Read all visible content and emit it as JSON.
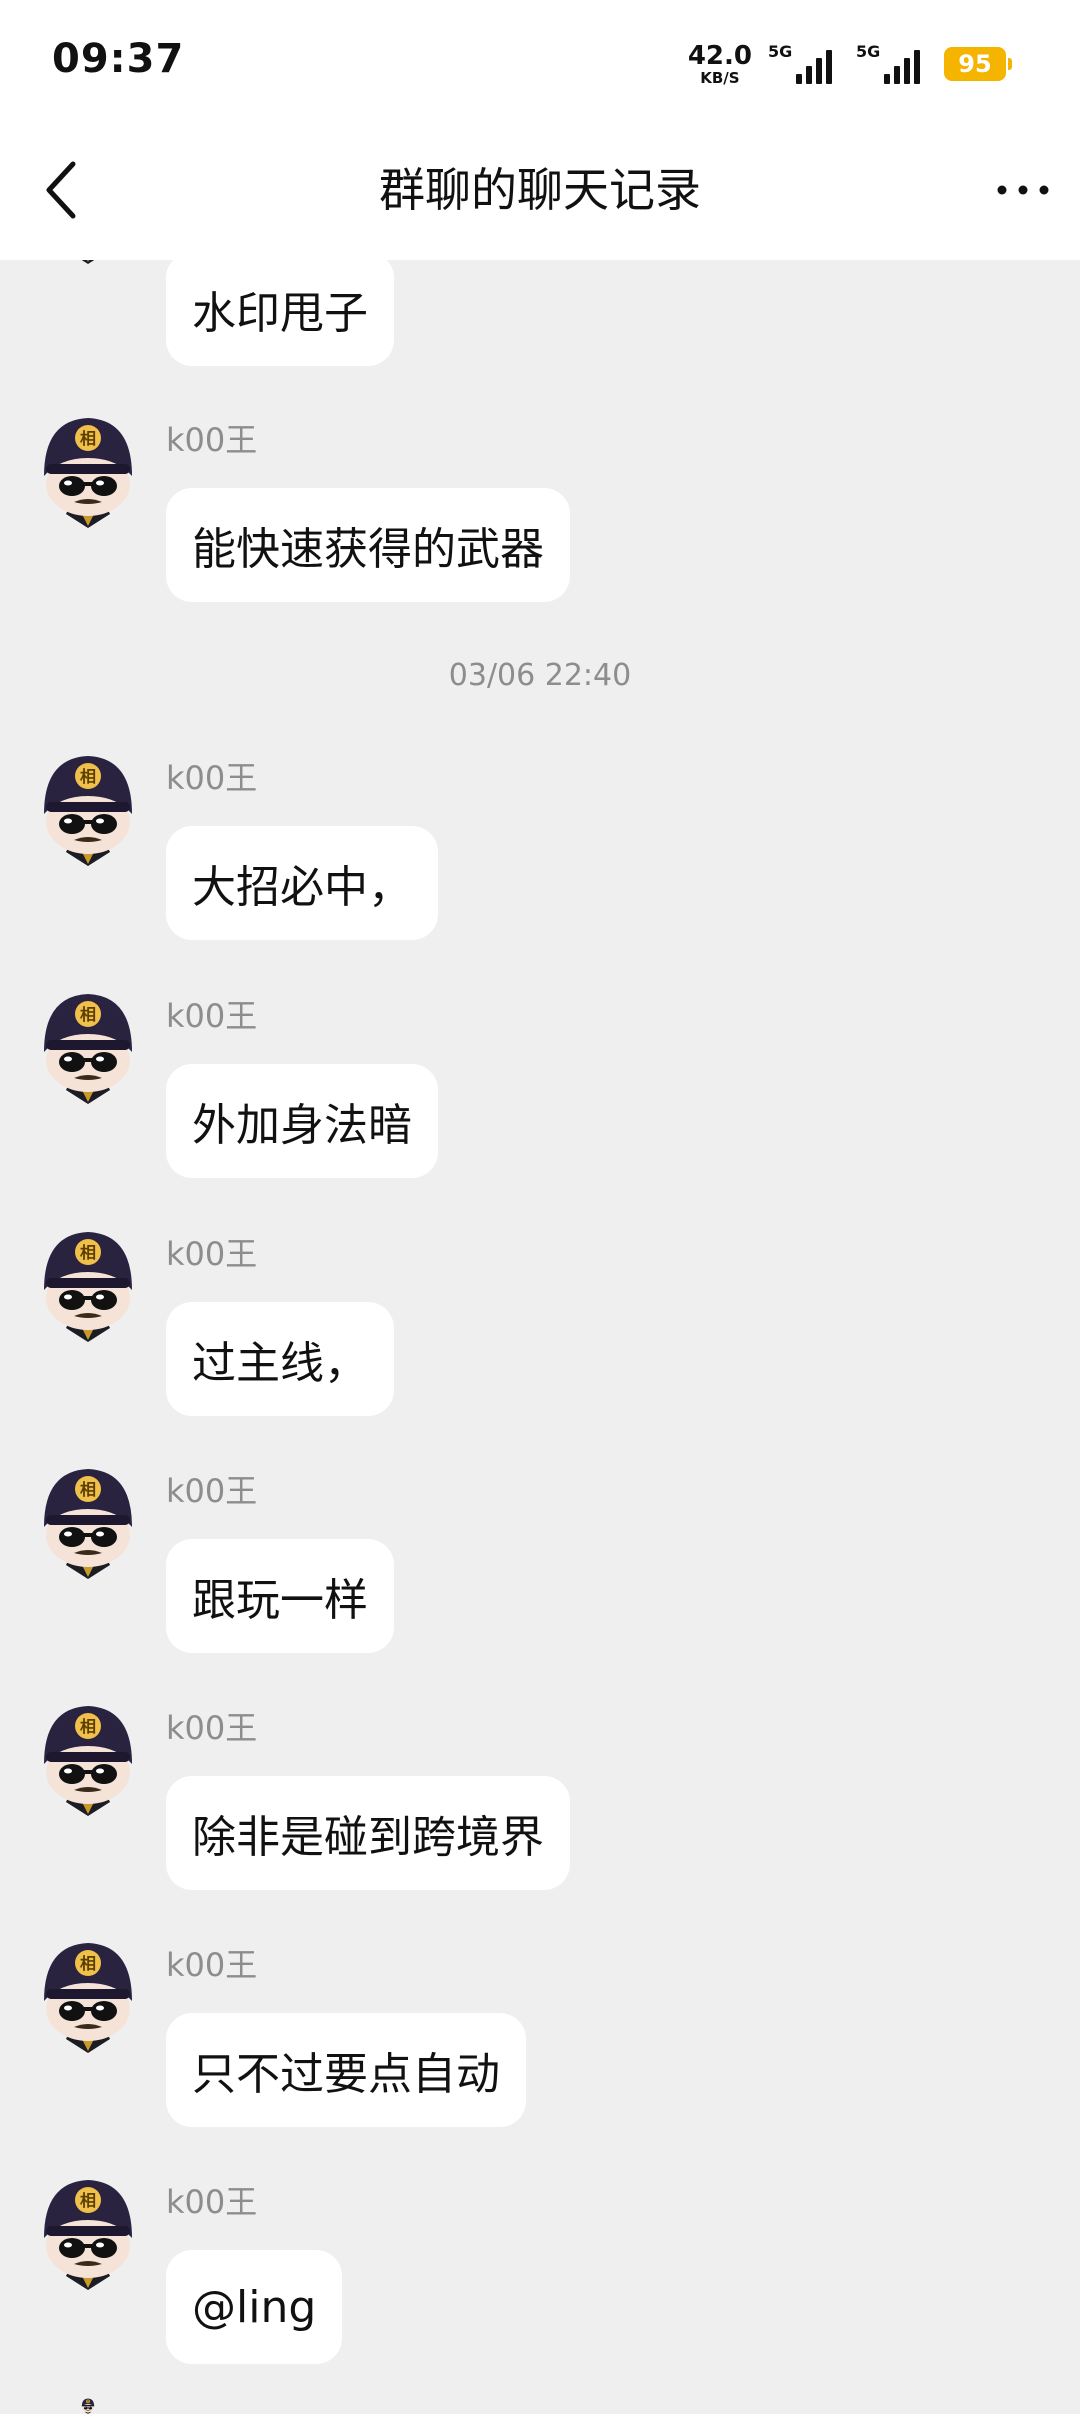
{
  "status_bar": {
    "time": "09:37",
    "net_speed": "42.0",
    "net_unit": "KB/S",
    "sim1_label": "5G",
    "sim2_label": "5G",
    "battery": "95"
  },
  "header": {
    "title": "群聊的聊天记录"
  },
  "timestamp": "03/06 22:40",
  "messages": [
    {
      "sender": "",
      "text": "水印甩子"
    },
    {
      "sender": "k00王",
      "text": "能快速获得的武器"
    },
    {
      "sender": "k00王",
      "text": "大招必中，"
    },
    {
      "sender": "k00王",
      "text": "外加身法暗"
    },
    {
      "sender": "k00王",
      "text": "过主线，"
    },
    {
      "sender": "k00王",
      "text": "跟玩一样"
    },
    {
      "sender": "k00王",
      "text": "除非是碰到跨境界"
    },
    {
      "sender": "k00王",
      "text": "只不过要点自动"
    },
    {
      "sender": "k00王",
      "text": "@ling"
    }
  ],
  "colors": {
    "background": "#efefef",
    "bubble": "#ffffff",
    "battery": "#f5b400",
    "avatar_hat": "#2a2340",
    "avatar_badge": "#f0c04a"
  },
  "avatar_badge_char": "相"
}
